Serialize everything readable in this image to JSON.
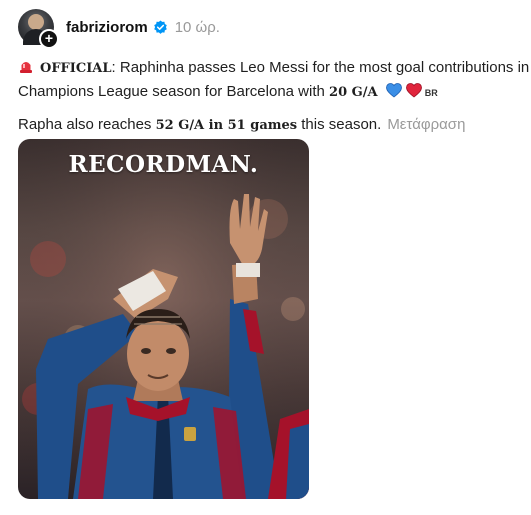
{
  "header": {
    "username": "fabriziorom",
    "time": "10 ώρ."
  },
  "post": {
    "official": "OFFICIAL",
    "line1_rest": ": Raphinha passes Leo Messi for the most goal contributions in a",
    "line2_text": "Champions League season for Barcelona with ",
    "line2_bold": "20 G/A",
    "br": "BR",
    "line3_a": "Rapha also reaches ",
    "line3_bold1": "52 G/A",
    "line3_mid": " in ",
    "line3_bold2": "51 games",
    "line3_end": " this season.",
    "translate": "Μετάφραση"
  },
  "media": {
    "caption": "RECORDMAN."
  },
  "icons": {
    "siren": "siren-icon",
    "verified": "verified-badge-icon",
    "blue_heart": "blue-heart-icon",
    "red_heart": "red-heart-icon"
  },
  "colors": {
    "verified": "#0095f6",
    "blue_heart": "#3a8ee6",
    "red_heart": "#e0243c",
    "translate": "#9a9a9a",
    "jacket_blue": "#1f4e8a",
    "jacket_red": "#a5122a"
  }
}
